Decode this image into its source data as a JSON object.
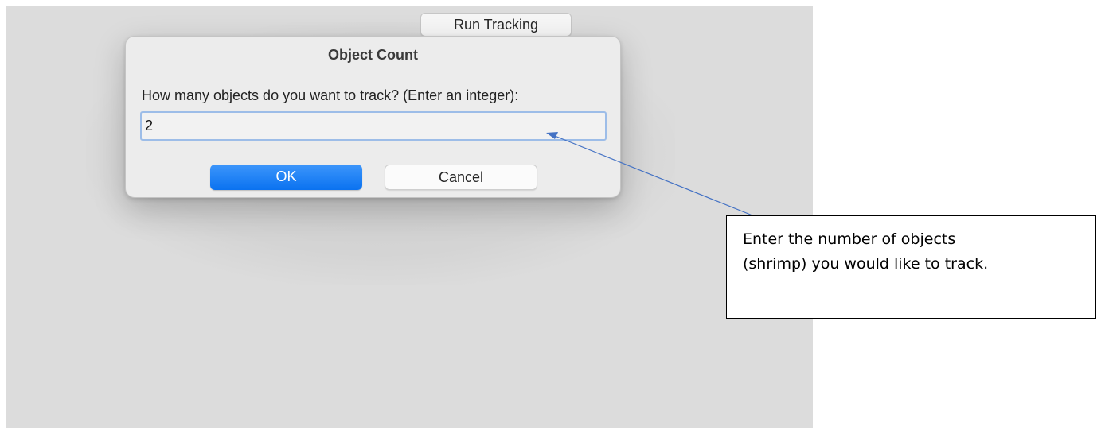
{
  "toolbar": {
    "run_tracking_label": "Run Tracking"
  },
  "dialog": {
    "title": "Object Count",
    "prompt": "How many objects do you want to track? (Enter an integer):",
    "input_value": "2",
    "ok_label": "OK",
    "cancel_label": "Cancel"
  },
  "annotation": {
    "lines": [
      "Enter the number of objects",
      "(shrimp) you would like to track."
    ],
    "arrow_color": "#4472c4"
  },
  "colors": {
    "ok_button": "#0a72f0",
    "window_background": "#dcdcdc",
    "input_focus_ring": "#9dbde8"
  }
}
